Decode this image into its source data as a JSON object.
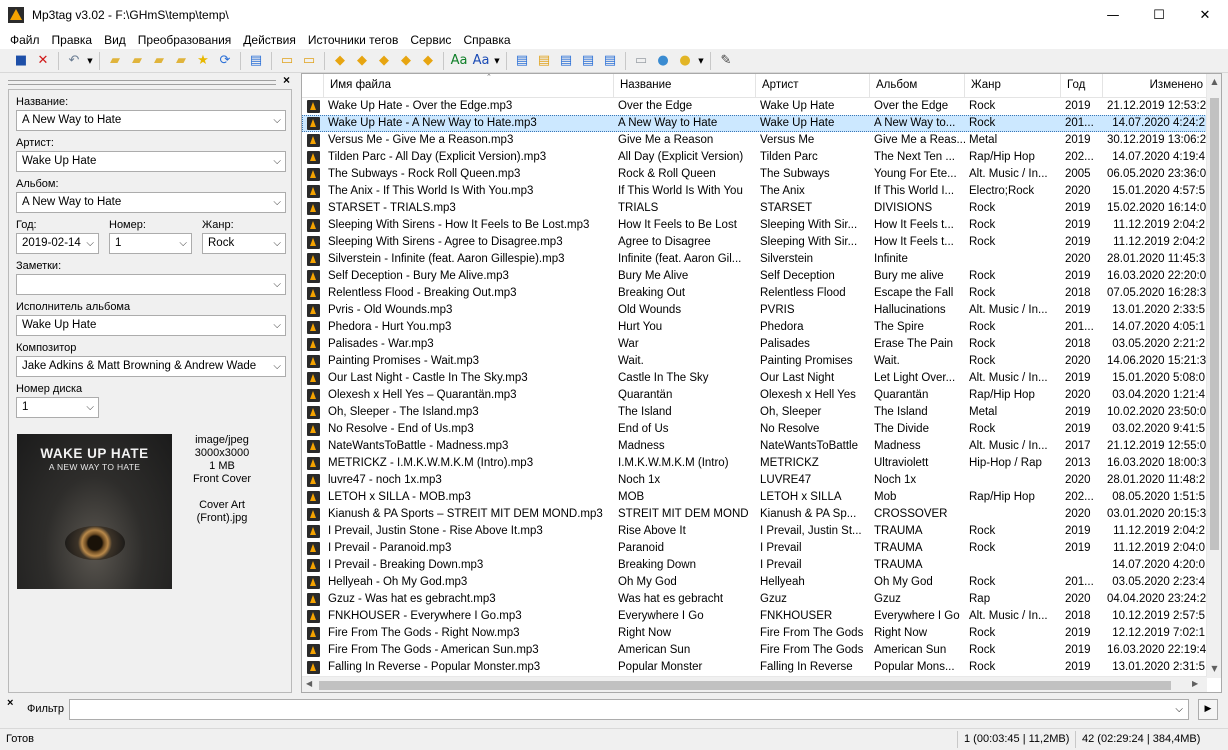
{
  "window": {
    "title": "Mp3tag v3.02  -  F:\\GHmS\\temp\\temp\\",
    "btn_minimize": "—",
    "btn_maximize": "☐",
    "btn_close": "✕"
  },
  "menu": [
    "Файл",
    "Правка",
    "Вид",
    "Преобразования",
    "Действия",
    "Источники тегов",
    "Сервис",
    "Справка"
  ],
  "toolbar": [
    {
      "icon": "save-icon",
      "glyph": "■",
      "color": "#1d4fa8"
    },
    {
      "icon": "remove-tag-icon",
      "glyph": "✕",
      "color": "#d01818"
    },
    {
      "icon": "undo-icon",
      "glyph": "↶",
      "color": "#6b7d93"
    },
    {
      "icon": "open-folder-icon",
      "glyph": "▰",
      "color": "#e0b43c"
    },
    {
      "icon": "add-folder-icon",
      "glyph": "▰",
      "color": "#e0b43c"
    },
    {
      "icon": "folder-up-icon",
      "glyph": "▰",
      "color": "#e0b43c"
    },
    {
      "icon": "folder-playlist-icon",
      "glyph": "▰",
      "color": "#e0b43c"
    },
    {
      "icon": "favorites-icon",
      "glyph": "★",
      "color": "#e8b800"
    },
    {
      "icon": "refresh-icon",
      "glyph": "⟳",
      "color": "#2a6fd6"
    },
    {
      "icon": "list-icon",
      "glyph": "▤",
      "color": "#2a6fd6"
    },
    {
      "icon": "copy-tag-icon",
      "glyph": "▭",
      "color": "#e0a31f"
    },
    {
      "icon": "paste-tag-icon",
      "glyph": "▭",
      "color": "#e0a31f"
    },
    {
      "icon": "tag-filename-icon",
      "glyph": "◆",
      "color": "#e7a511"
    },
    {
      "icon": "filename-tag-icon",
      "glyph": "◆",
      "color": "#e7a511"
    },
    {
      "icon": "text-tag-icon",
      "glyph": "◆",
      "color": "#e7a511"
    },
    {
      "icon": "tag-tag-icon",
      "glyph": "◆",
      "color": "#e7a511"
    },
    {
      "icon": "autonumber-icon",
      "glyph": "◆",
      "color": "#e7a511"
    },
    {
      "icon": "convert-icon",
      "glyph": "Aa",
      "color": "#0f7f28"
    },
    {
      "icon": "case-icon",
      "glyph": "Aa",
      "color": "#1b4bb5"
    },
    {
      "icon": "export-icon",
      "glyph": "▤",
      "color": "#2a6fd6"
    },
    {
      "icon": "playlist-icon",
      "glyph": "▤",
      "color": "#e0a31f"
    },
    {
      "icon": "import-icon",
      "glyph": "▤",
      "color": "#2a6fd6"
    },
    {
      "icon": "export-list-icon",
      "glyph": "▤",
      "color": "#2a6fd6"
    },
    {
      "icon": "number-icon",
      "glyph": "▤",
      "color": "#2a6fd6"
    },
    {
      "icon": "print-icon",
      "glyph": "▭",
      "color": "#9aa0a6"
    },
    {
      "icon": "web-source-icon",
      "glyph": "●",
      "color": "#3a8bd1"
    },
    {
      "icon": "globe-icon",
      "glyph": "●",
      "color": "#e2b526"
    },
    {
      "icon": "settings-icon",
      "glyph": "✎",
      "color": "#444444"
    }
  ],
  "editor": {
    "close": "×",
    "title_label": "Название:",
    "title_value": "A New Way to Hate",
    "artist_label": "Артист:",
    "artist_value": "Wake Up Hate",
    "album_label": "Альбом:",
    "album_value": "A New Way to Hate",
    "year_label": "Год:",
    "year_value": "2019-02-14",
    "track_label": "Номер:",
    "track_value": "1",
    "genre_label": "Жанр:",
    "genre_value": "Rock",
    "comment_label": "Заметки:",
    "comment_value": "",
    "album_artist_label": "Исполнитель альбома",
    "album_artist_value": "Wake Up Hate",
    "composer_label": "Композитор",
    "composer_value": "Jake Adkins & Matt Browning & Andrew Wade",
    "disc_label": "Номер диска",
    "disc_value": "1",
    "cover": {
      "art_title": "WAKE UP HATE",
      "art_subtitle": "A NEW WAY TO HATE",
      "mime": "image/jpeg",
      "dims": "3000x3000",
      "size": "1 MB",
      "type": "Front Cover",
      "desc_line1": "Cover Art",
      "desc_line2": "(Front).jpg"
    }
  },
  "columns": [
    "Имя файла",
    "Название",
    "Артист",
    "Альбом",
    "Жанр",
    "Год",
    "Изменено"
  ],
  "files": [
    {
      "f": "Wake Up Hate - Over the Edge.mp3",
      "t": "Over the Edge",
      "a": "Wake Up Hate",
      "al": "Over the Edge",
      "g": "Rock",
      "y": "2019",
      "m": "21.12.2019 12:53:2"
    },
    {
      "f": "Wake Up Hate - A New Way to Hate.mp3",
      "t": "A New Way to Hate",
      "a": "Wake Up Hate",
      "al": "A New Way to...",
      "g": "Rock",
      "y": "201...",
      "m": "14.07.2020 4:24:2"
    },
    {
      "f": "Versus Me - Give Me a Reason.mp3",
      "t": "Give Me a Reason",
      "a": "Versus Me",
      "al": "Give Me a Reas...",
      "g": "Metal",
      "y": "2019",
      "m": "30.12.2019 13:06:2"
    },
    {
      "f": "Tilden Parc - All Day (Explicit Version).mp3",
      "t": "All Day (Explicit Version)",
      "a": "Tilden Parc",
      "al": "The Next Ten ...",
      "g": "Rap/Hip Hop",
      "y": "202...",
      "m": "14.07.2020 4:19:4"
    },
    {
      "f": "The Subways - Rock  Roll Queen.mp3",
      "t": "Rock & Roll Queen",
      "a": "The Subways",
      "al": "Young For Ete...",
      "g": "Alt. Music / In...",
      "y": "2005",
      "m": "06.05.2020 23:36:0"
    },
    {
      "f": "The Anix - If This World Is With You.mp3",
      "t": "If This World Is With You",
      "a": "The Anix",
      "al": "If This World I...",
      "g": "Electro;Rock",
      "y": "2020",
      "m": "15.01.2020 4:57:5"
    },
    {
      "f": "STARSET - TRIALS.mp3",
      "t": "TRIALS",
      "a": "STARSET",
      "al": "DIVISIONS",
      "g": "Rock",
      "y": "2019",
      "m": "15.02.2020 16:14:0"
    },
    {
      "f": "Sleeping With Sirens - How It Feels to Be Lost.mp3",
      "t": "How It Feels to Be Lost",
      "a": "Sleeping With Sir...",
      "al": "How It Feels t...",
      "g": "Rock",
      "y": "2019",
      "m": "11.12.2019 2:04:2"
    },
    {
      "f": "Sleeping With Sirens - Agree to Disagree.mp3",
      "t": "Agree to Disagree",
      "a": "Sleeping With Sir...",
      "al": "How It Feels t...",
      "g": "Rock",
      "y": "2019",
      "m": "11.12.2019 2:04:2"
    },
    {
      "f": "Silverstein - Infinite (feat. Aaron Gillespie).mp3",
      "t": "Infinite (feat. Aaron Gil...",
      "a": "Silverstein",
      "al": "Infinite",
      "g": "",
      "y": "2020",
      "m": "28.01.2020 11:45:3"
    },
    {
      "f": "Self Deception - Bury Me Alive.mp3",
      "t": "Bury Me Alive",
      "a": "Self Deception",
      "al": "Bury me alive",
      "g": "Rock",
      "y": "2019",
      "m": "16.03.2020 22:20:0"
    },
    {
      "f": "Relentless Flood - Breaking Out.mp3",
      "t": "Breaking Out",
      "a": "Relentless Flood",
      "al": "Escape the Fall",
      "g": "Rock",
      "y": "2018",
      "m": "07.05.2020 16:28:3"
    },
    {
      "f": "Pvris - Old Wounds.mp3",
      "t": "Old Wounds",
      "a": "PVRIS",
      "al": "Hallucinations",
      "g": "Alt. Music / In...",
      "y": "2019",
      "m": "13.01.2020 2:33:5"
    },
    {
      "f": "Phedora - Hurt You.mp3",
      "t": "Hurt You",
      "a": "Phedora",
      "al": "The Spire",
      "g": "Rock",
      "y": "201...",
      "m": "14.07.2020 4:05:1"
    },
    {
      "f": "Palisades - War.mp3",
      "t": "War",
      "a": "Palisades",
      "al": "Erase The Pain",
      "g": "Rock",
      "y": "2018",
      "m": "03.05.2020 2:21:2"
    },
    {
      "f": "Painting Promises - Wait.mp3",
      "t": "Wait.",
      "a": "Painting Promises",
      "al": "Wait.",
      "g": "Rock",
      "y": "2020",
      "m": "14.06.2020 15:21:3"
    },
    {
      "f": "Our Last Night - Castle In The Sky.mp3",
      "t": "Castle In The Sky",
      "a": "Our Last Night",
      "al": "Let Light Over...",
      "g": "Alt. Music / In...",
      "y": "2019",
      "m": "15.01.2020 5:08:0"
    },
    {
      "f": "Olexesh x Hell Yes – Quarantän.mp3",
      "t": "Quarantän",
      "a": "Olexesh x Hell Yes",
      "al": "Quarantän",
      "g": "Rap/Hip Hop",
      "y": "2020",
      "m": "03.04.2020 1:21:4"
    },
    {
      "f": "Oh, Sleeper - The Island.mp3",
      "t": "The Island",
      "a": "Oh, Sleeper",
      "al": "The Island",
      "g": "Metal",
      "y": "2019",
      "m": "10.02.2020 23:50:0"
    },
    {
      "f": "No Resolve - End of Us.mp3",
      "t": "End of Us",
      "a": "No Resolve",
      "al": "The Divide",
      "g": "Rock",
      "y": "2019",
      "m": "03.02.2020 9:41:5"
    },
    {
      "f": "NateWantsToBattle - Madness.mp3",
      "t": "Madness",
      "a": "NateWantsToBattle",
      "al": "Madness",
      "g": "Alt. Music / In...",
      "y": "2017",
      "m": "21.12.2019 12:55:0"
    },
    {
      "f": "METRICKZ - I.M.K.W.M.K.M (Intro).mp3",
      "t": " I.M.K.W.M.K.M (Intro)",
      "a": "METRICKZ",
      "al": "Ultraviolett",
      "g": "Hip-Hop / Rap",
      "y": "2013",
      "m": "16.03.2020 18:00:3"
    },
    {
      "f": "luvre47 - noch 1x.mp3",
      "t": "Noch 1x",
      "a": "LUVRE47",
      "al": "Noch 1x",
      "g": "",
      "y": "2020",
      "m": "28.01.2020 11:48:2"
    },
    {
      "f": "LETOH x SILLA  - MOB.mp3",
      "t": "MOB",
      "a": "LETOH x SILLA",
      "al": "Mob",
      "g": "Rap/Hip Hop",
      "y": "202...",
      "m": "08.05.2020 1:51:5"
    },
    {
      "f": "Kianush & PA Sports – STREIT MIT DEM MOND.mp3",
      "t": "STREIT MIT DEM MOND",
      "a": "Kianush & PA Sp...",
      "al": "CROSSOVER",
      "g": "",
      "y": "2020",
      "m": "03.01.2020 20:15:3"
    },
    {
      "f": "I Prevail, Justin Stone - Rise Above It.mp3",
      "t": "Rise Above It",
      "a": "I Prevail, Justin St...",
      "al": "TRAUMA",
      "g": "Rock",
      "y": "2019",
      "m": "11.12.2019 2:04:2"
    },
    {
      "f": "I Prevail - Paranoid.mp3",
      "t": "Paranoid",
      "a": "I Prevail",
      "al": "TRAUMA",
      "g": "Rock",
      "y": "2019",
      "m": "11.12.2019 2:04:0"
    },
    {
      "f": "I Prevail - Breaking Down.mp3",
      "t": "Breaking Down",
      "a": "I Prevail",
      "al": "TRAUMA",
      "g": "",
      "y": "",
      "m": "14.07.2020 4:20:0"
    },
    {
      "f": "Hellyeah - Oh My God.mp3",
      "t": "Oh My God",
      "a": "Hellyeah",
      "al": "Oh My God",
      "g": "Rock",
      "y": "201...",
      "m": "03.05.2020 2:23:4"
    },
    {
      "f": "Gzuz - Was hat es gebracht.mp3",
      "t": "Was hat es gebracht",
      "a": "Gzuz",
      "al": "Gzuz",
      "g": "Rap",
      "y": "2020",
      "m": "04.04.2020 23:24:2"
    },
    {
      "f": "FNKHOUSER - Everywhere I Go.mp3",
      "t": "Everywhere I Go",
      "a": "FNKHOUSER",
      "al": "Everywhere I Go",
      "g": "Alt. Music / In...",
      "y": "2018",
      "m": "10.12.2019 2:57:5"
    },
    {
      "f": "Fire From The Gods - Right Now.mp3",
      "t": "Right Now",
      "a": "Fire From The Gods",
      "al": "Right Now",
      "g": "Rock",
      "y": "2019",
      "m": "12.12.2019 7:02:1"
    },
    {
      "f": "Fire From The Gods - American Sun.mp3",
      "t": "American Sun",
      "a": "Fire From The Gods",
      "al": "American Sun",
      "g": "Rock",
      "y": "2019",
      "m": "16.03.2020 22:19:4"
    },
    {
      "f": "Falling In Reverse - Popular Monster.mp3",
      "t": "Popular Monster",
      "a": "Falling In Reverse",
      "al": "Popular Mons...",
      "g": "Rock",
      "y": "2019",
      "m": "13.01.2020 2:31:5"
    }
  ],
  "selected_index": 1,
  "filter": {
    "label": "Фильтр",
    "value": "",
    "close": "×"
  },
  "status": {
    "ready": "Готов",
    "selection": "1 (00:03:45 | 11,2MB)",
    "total": "42 (02:29:24 | 384,4MB)"
  }
}
